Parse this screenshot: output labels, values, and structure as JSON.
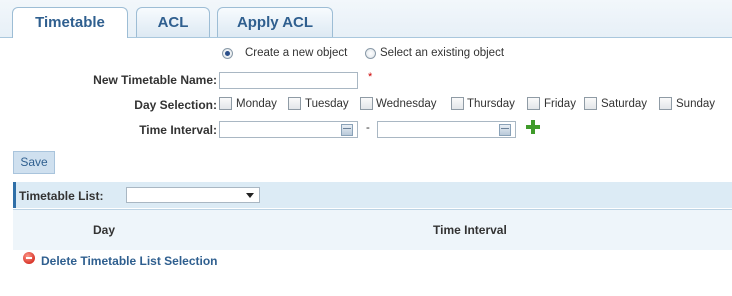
{
  "tabs": [
    {
      "label": "Timetable"
    },
    {
      "label": "ACL"
    },
    {
      "label": "Apply ACL"
    }
  ],
  "form": {
    "radio_new": "Create a new object",
    "radio_existing": "Select an existing object",
    "name_label": "New Timetable Name:",
    "name_value": "",
    "required_mark": "*",
    "day_label": "Day Selection:",
    "days": [
      "Monday",
      "Tuesday",
      "Wednesday",
      "Thursday",
      "Friday",
      "Saturday",
      "Sunday"
    ],
    "interval_label": "Time Interval:",
    "interval_from": "",
    "interval_to": "",
    "interval_sep": "-",
    "save_label": "Save"
  },
  "list": {
    "label": "Timetable List:",
    "selected": "",
    "columns": [
      "Day",
      "Time Interval"
    ],
    "delete_label": "Delete Timetable List Selection"
  },
  "colors": {
    "accent": "#2f5f8f",
    "bar_bg": "#dcebf5",
    "required": "#cc0000",
    "add_green": "#3f9b2a",
    "delete_red": "#d8352a"
  },
  "icons": {
    "calendar": "calendar-icon",
    "add": "add-icon",
    "delete": "delete-icon",
    "dropdown": "chevron-down-icon"
  }
}
